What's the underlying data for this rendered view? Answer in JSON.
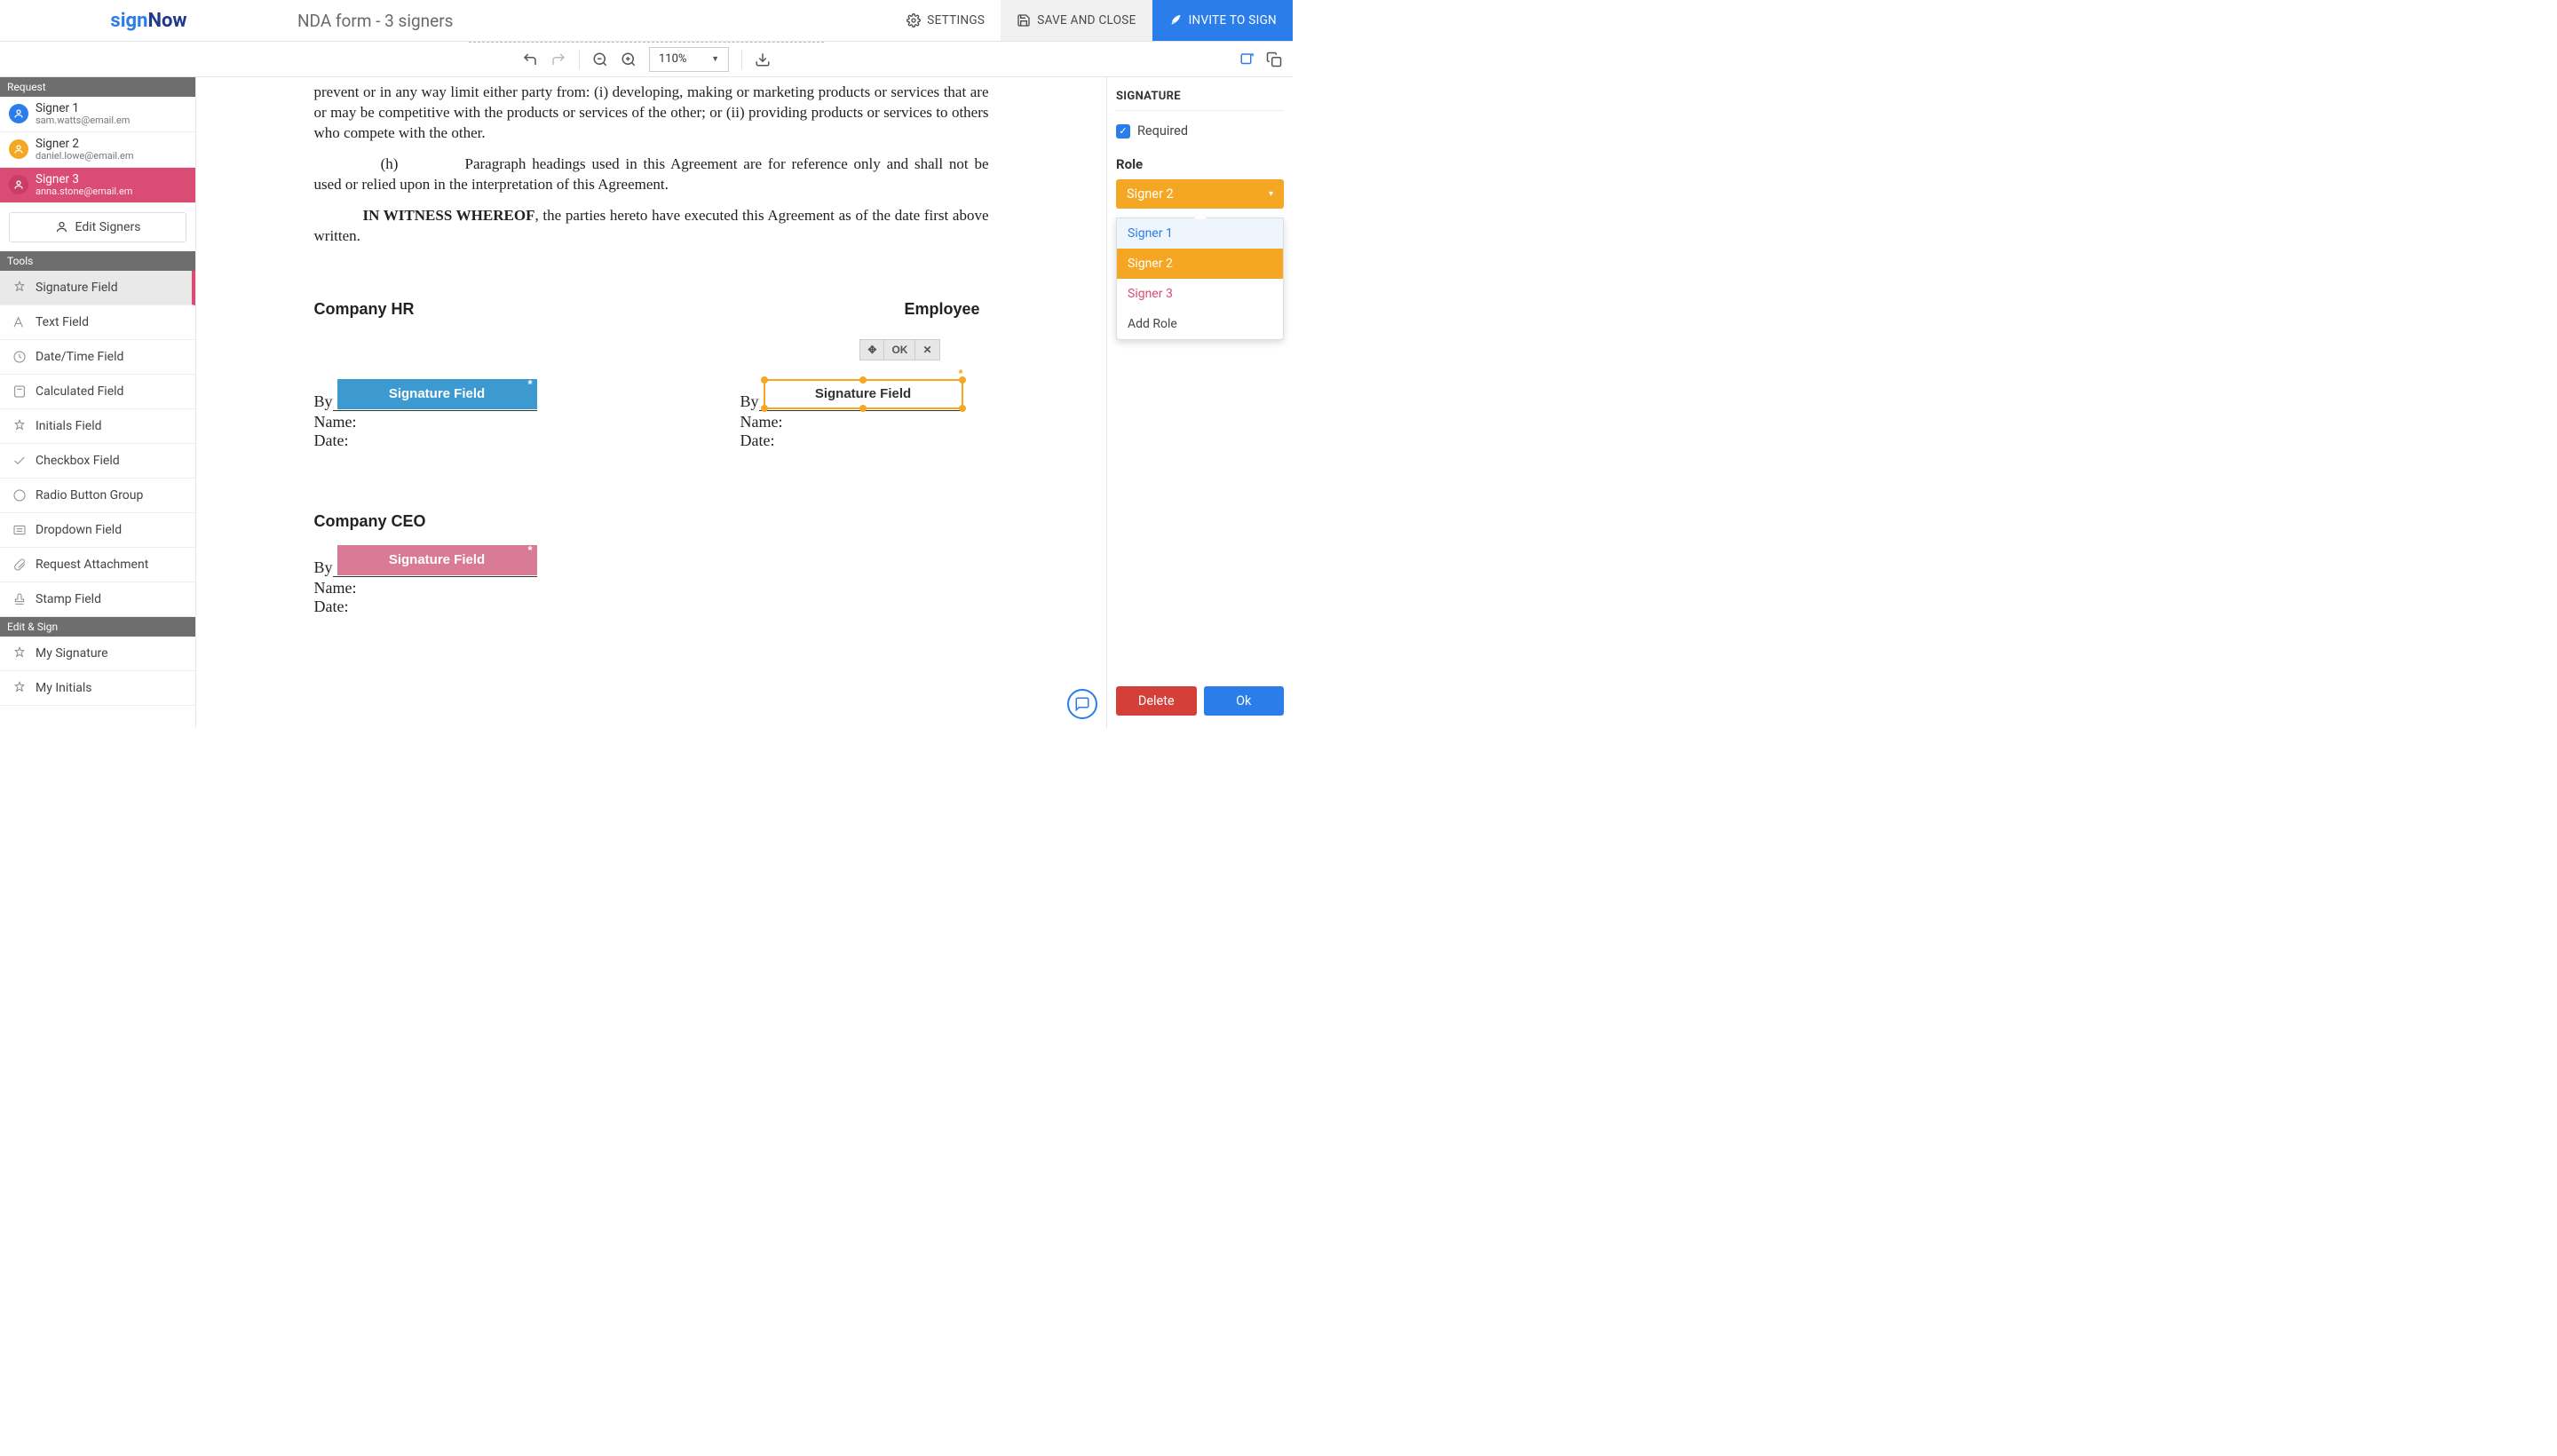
{
  "brand": {
    "part1": "sign",
    "part2": "Now"
  },
  "document": {
    "title": "NDA form - 3 signers"
  },
  "topbar": {
    "settings": "SETTINGS",
    "save": "SAVE AND CLOSE",
    "invite": "INVITE TO SIGN"
  },
  "toolbar": {
    "zoom": "110%"
  },
  "sidebar_left": {
    "request_header": "Request",
    "signers": [
      {
        "name": "Signer 1",
        "email": "sam.watts@email.em",
        "avatar_bg": "#2b7de9"
      },
      {
        "name": "Signer 2",
        "email": "daniel.lowe@email.em",
        "avatar_bg": "#f5a623"
      },
      {
        "name": "Signer 3",
        "email": "anna.stone@email.em",
        "avatar_bg": "#da4c74"
      }
    ],
    "edit_signers": "Edit Signers",
    "tools_header": "Tools",
    "tools": [
      "Signature Field",
      "Text Field",
      "Date/Time Field",
      "Calculated Field",
      "Initials Field",
      "Checkbox Field",
      "Radio Button Group",
      "Dropdown Field",
      "Request Attachment",
      "Stamp Field"
    ],
    "edit_sign_header": "Edit & Sign",
    "edit_sign": [
      "My Signature",
      "My Initials"
    ]
  },
  "doc": {
    "p1": "prevent or in any way limit either party from: (i) developing, making or marketing products or services that are or may be competitive with the products or services of the other; or (ii) providing products or services to others who compete with the other.",
    "p2_lead": "(h)",
    "p2": "Paragraph headings used in this Agreement are for reference only and shall not be used or relied upon in the interpretation of this Agreement.",
    "witness_bold": "IN WITNESS WHEREOF",
    "witness_rest": ", the parties hereto have executed this Agreement as of the date first above written.",
    "col1_head": "Company HR",
    "col2_head": "Employee",
    "by": "By",
    "name": "Name:",
    "date": "Date:",
    "ceo_head": "Company CEO",
    "sig_label": "Signature Field"
  },
  "field_toolbar": {
    "move": "✥",
    "ok": "OK",
    "close": "✕"
  },
  "sidebar_right": {
    "title": "SIGNATURE",
    "required": "Required",
    "role_label": "Role",
    "selected_role": "Signer 2",
    "options": [
      {
        "label": "Signer 1",
        "cls": "s1"
      },
      {
        "label": "Signer 2",
        "cls": "s2"
      },
      {
        "label": "Signer 3",
        "cls": "s3"
      },
      {
        "label": "Add Role",
        "cls": "add"
      }
    ],
    "delete": "Delete",
    "ok": "Ok"
  }
}
